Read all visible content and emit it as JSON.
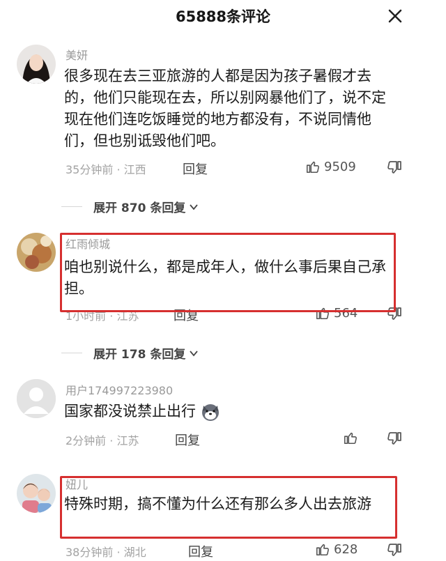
{
  "header": {
    "title": "65888条评论"
  },
  "comments": [
    {
      "username": "美妍",
      "text": "很多现在去三亚旅游的人都是因为孩子暑假才去的，他们只能现在去，所以别网暴他们了，说不定现在他们连吃饭睡觉的地方都没有，不说同情他们，但也别诋毁他们吧。",
      "meta": "35分钟前 · 江西",
      "reply_label": "回复",
      "likes": "9509",
      "expand_label": "展开 870 条回复"
    },
    {
      "username": "红雨倾城",
      "text": "咱也别说什么，都是成年人，做什么事后果自己承担。",
      "meta": "1小时前 · 江苏",
      "reply_label": "回复",
      "likes": "564",
      "expand_label": "展开 178 条回复"
    },
    {
      "username": "用户174997223980",
      "text": "国家都没说禁止出行",
      "meta": "2分钟前 · 江苏",
      "reply_label": "回复",
      "likes": ""
    },
    {
      "username": "妞儿",
      "text": "特殊时期，搞不懂为什么还有那么多人出去旅游",
      "meta": "38分钟前 · 湖北",
      "reply_label": "回复",
      "likes": "628"
    }
  ],
  "colors": {
    "highlight": "#d62f2f",
    "meta": "#a3a3a3",
    "text": "#1b1b1b"
  },
  "icons": [
    "close-icon",
    "thumbs-up-icon",
    "thumbs-down-icon",
    "chevron-down-icon",
    "dog-emoji-icon"
  ]
}
